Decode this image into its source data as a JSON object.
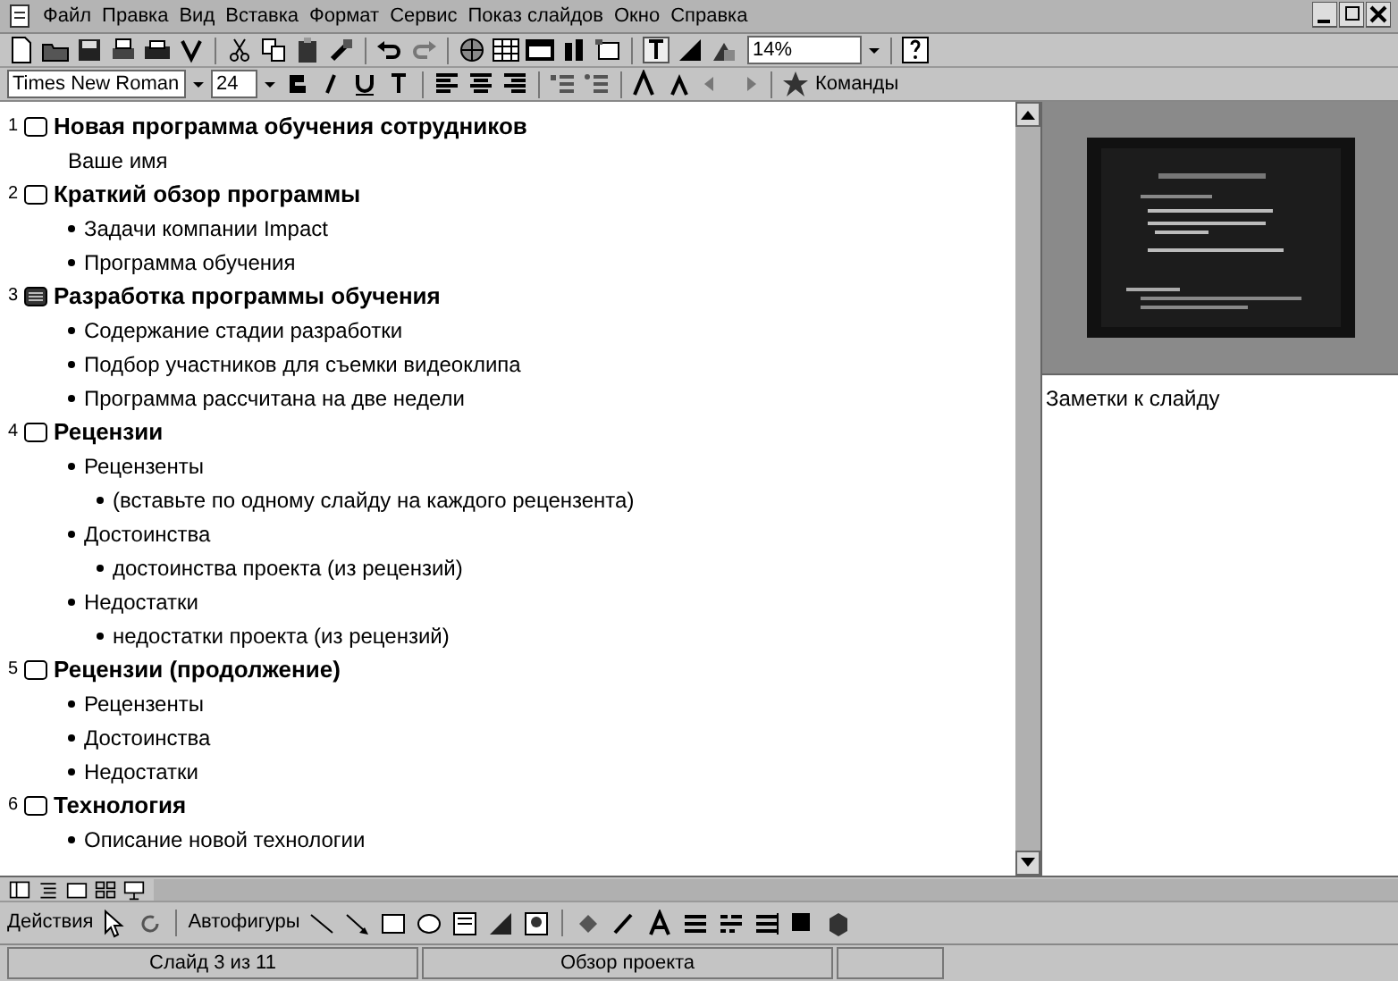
{
  "menu": [
    "Файл",
    "Правка",
    "Вид",
    "Вставка",
    "Формат",
    "Сервис",
    "Показ слайдов",
    "Окно",
    "Справка"
  ],
  "standard_toolbar": {
    "zoom": "14%"
  },
  "formatting_toolbar": {
    "font": "Times New Roman",
    "size": "24",
    "commands": "Команды"
  },
  "outline": [
    {
      "number": "1",
      "title": "Новая программа обучения сотрудников",
      "selected": false,
      "children": [
        {
          "kind": "text",
          "text": "Ваше имя"
        }
      ]
    },
    {
      "number": "2",
      "title": "Краткий обзор программы",
      "selected": false,
      "children": [
        {
          "kind": "bullet",
          "text": "Задачи компании Impact"
        },
        {
          "kind": "bullet",
          "text": "Программа обучения"
        }
      ]
    },
    {
      "number": "3",
      "title": "Разработка программы обучения",
      "selected": true,
      "children": [
        {
          "kind": "bullet",
          "text": "Содержание стадии разработки"
        },
        {
          "kind": "bullet",
          "text": "Подбор участников для съемки видеоклипа"
        },
        {
          "kind": "bullet",
          "text": "Программа рассчитана на две недели"
        }
      ]
    },
    {
      "number": "4",
      "title": "Рецензии",
      "selected": false,
      "children": [
        {
          "kind": "bullet",
          "text": "Рецензенты",
          "children": [
            {
              "kind": "bullet",
              "text": "(вставьте по одному слайду на каждого рецензента)"
            }
          ]
        },
        {
          "kind": "bullet",
          "text": "Достоинства",
          "children": [
            {
              "kind": "bullet",
              "text": "достоинства проекта (из рецензий)"
            }
          ]
        },
        {
          "kind": "bullet",
          "text": "Недостатки",
          "children": [
            {
              "kind": "bullet",
              "text": "недостатки проекта (из рецензий)"
            }
          ]
        }
      ]
    },
    {
      "number": "5",
      "title": "Рецензии (продолжение)",
      "selected": false,
      "children": [
        {
          "kind": "bullet",
          "text": "Рецензенты"
        },
        {
          "kind": "bullet",
          "text": "Достоинства"
        },
        {
          "kind": "bullet",
          "text": "Недостатки"
        }
      ]
    },
    {
      "number": "6",
      "title": "Технология",
      "selected": false,
      "children": [
        {
          "kind": "bullet",
          "text": "Описание новой технологии"
        }
      ]
    }
  ],
  "notes": {
    "placeholder": "Заметки к слайду"
  },
  "drawing_toolbar": {
    "actions": "Действия",
    "autoshapes": "Автофигуры"
  },
  "status_bar": {
    "slide": "Слайд 3 из 11",
    "design": "Обзор проекта"
  }
}
